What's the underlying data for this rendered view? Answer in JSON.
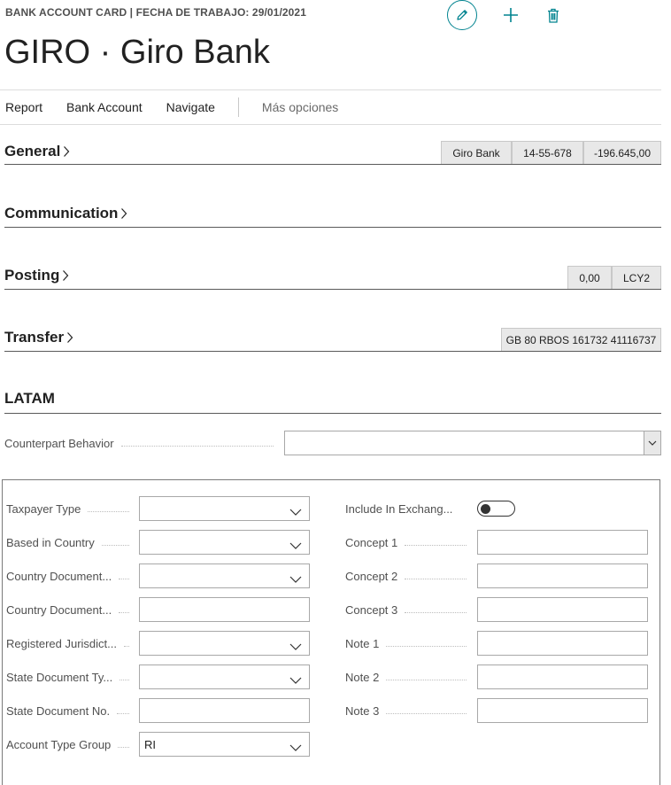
{
  "header": {
    "breadcrumb": "BANK ACCOUNT CARD | FECHA DE TRABAJO: 29/01/2021",
    "title": "GIRO · Giro Bank"
  },
  "toolbar": {
    "edit_icon": "pencil-icon",
    "new_icon": "plus-icon",
    "delete_icon": "trash-icon"
  },
  "menu": {
    "items": [
      "Report",
      "Bank Account",
      "Navigate"
    ],
    "more": "Más opciones"
  },
  "sections": {
    "general": {
      "title": "General",
      "chips": [
        "Giro Bank",
        "14-55-678",
        "-196.645,00"
      ]
    },
    "communication": {
      "title": "Communication"
    },
    "posting": {
      "title": "Posting",
      "chips": [
        "0,00",
        "LCY2"
      ]
    },
    "transfer": {
      "title": "Transfer",
      "chips": [
        "GB 80 RBOS 161732 41116737"
      ]
    },
    "latam": {
      "title": "LATAM"
    }
  },
  "latam": {
    "counterpart_behavior": {
      "label": "Counterpart Behavior",
      "value": ""
    },
    "left_fields": [
      {
        "label": "Taxpayer Type",
        "value": "",
        "type": "select"
      },
      {
        "label": "Based in Country",
        "value": "",
        "type": "select"
      },
      {
        "label": "Country Document...",
        "value": "",
        "type": "select"
      },
      {
        "label": "Country Document...",
        "value": "",
        "type": "text"
      },
      {
        "label": "Registered Jurisdict...",
        "value": "",
        "type": "select"
      },
      {
        "label": "State Document Ty...",
        "value": "",
        "type": "select"
      },
      {
        "label": "State Document No.",
        "value": "",
        "type": "text"
      },
      {
        "label": "Account Type Group",
        "value": "RI",
        "type": "select"
      }
    ],
    "right_fields": [
      {
        "label": "Include In Exchang...",
        "value": false,
        "type": "toggle"
      },
      {
        "label": "Concept 1",
        "value": "",
        "type": "text"
      },
      {
        "label": "Concept 2",
        "value": "",
        "type": "text"
      },
      {
        "label": "Concept 3",
        "value": "",
        "type": "text"
      },
      {
        "label": "Note 1",
        "value": "",
        "type": "text"
      },
      {
        "label": "Note 2",
        "value": "",
        "type": "text"
      },
      {
        "label": "Note 3",
        "value": "",
        "type": "text"
      }
    ]
  },
  "colors": {
    "accent": "#00838f",
    "text": "#212121",
    "muted": "#505050"
  }
}
